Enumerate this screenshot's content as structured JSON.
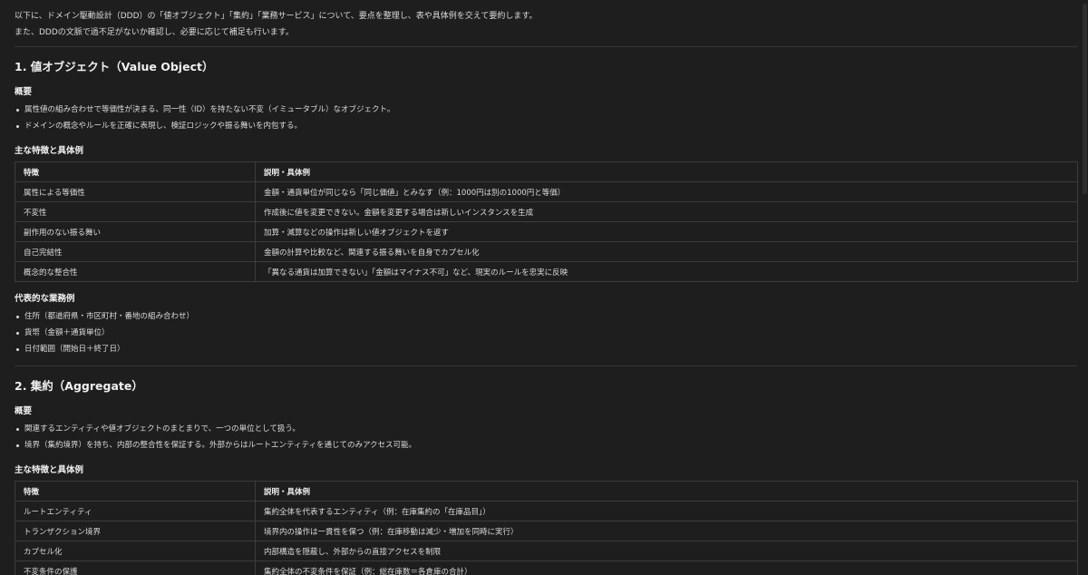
{
  "intro": [
    "以下に、ドメイン駆動設計（DDD）の「値オブジェクト」「集約」「業務サービス」について、要点を整理し、表や具体例を交えて要約します。",
    "また、DDDの文脈で過不足がないか確認し、必要に応じて補足も行います。"
  ],
  "section1": {
    "title": "1. 値オブジェクト（Value Object）",
    "overview_heading": "概要",
    "overview": [
      "属性値の組み合わせで等価性が決まる、同一性（ID）を持たない不変（イミュータブル）なオブジェクト。",
      "ドメインの概念やルールを正確に表現し、検証ロジックや振る舞いを内包する。"
    ],
    "features_heading": "主な特徴と具体例",
    "table": {
      "headers": [
        "特徴",
        "説明・具体例"
      ],
      "rows": [
        [
          "属性による等価性",
          "金額・通貨単位が同じなら「同じ価値」とみなす（例：1000円は別の1000円と等価）"
        ],
        [
          "不変性",
          "作成後に値を変更できない。金額を変更する場合は新しいインスタンスを生成"
        ],
        [
          "副作用のない振る舞い",
          "加算・減算などの操作は新しい値オブジェクトを返す"
        ],
        [
          "自己完結性",
          "金額の計算や比較など、関連する振る舞いを自身でカプセル化"
        ],
        [
          "概念的な整合性",
          "「異なる通貨は加算できない」「金額はマイナス不可」など、現実のルールを忠実に反映"
        ]
      ]
    },
    "examples_heading": "代表的な業務例",
    "examples": [
      "住所（都道府県・市区町村・番地の組み合わせ）",
      "貨幣（金額＋通貨単位）",
      "日付範囲（開始日＋終了日）"
    ]
  },
  "section2": {
    "title": "2. 集約（Aggregate）",
    "overview_heading": "概要",
    "overview": [
      "関連するエンティティや値オブジェクトのまとまりで、一つの単位として扱う。",
      "境界（集約境界）を持ち、内部の整合性を保証する。外部からはルートエンティティを通じてのみアクセス可能。"
    ],
    "features_heading": "主な特徴と具体例",
    "table": {
      "headers": [
        "特徴",
        "説明・具体例"
      ],
      "rows": [
        [
          "ルートエンティティ",
          "集約全体を代表するエンティティ（例：在庫集約の「在庫品目」）"
        ],
        [
          "トランザクション境界",
          "境界内の操作は一貫性を保つ（例：在庫移動は減少・増加を同時に実行）"
        ],
        [
          "カプセル化",
          "内部構造を隠蔽し、外部からの直接アクセスを制限"
        ],
        [
          "不変条件の保護",
          "集約全体の不変条件を保証（例：総在庫数＝各倉庫の合計）"
        ]
      ]
    }
  }
}
